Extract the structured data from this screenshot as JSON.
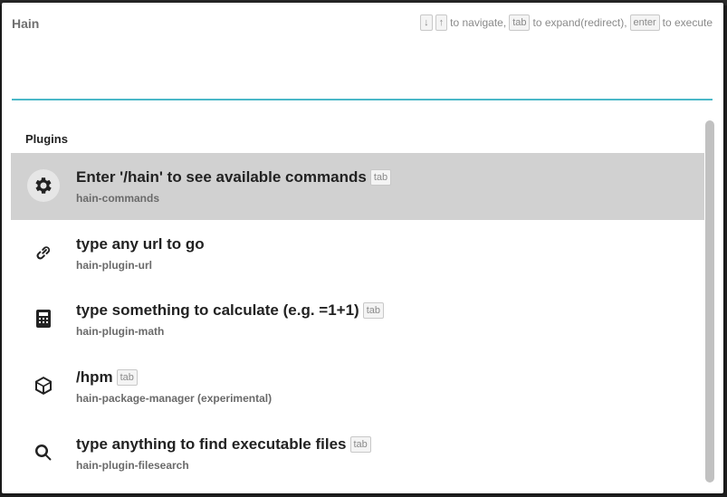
{
  "app": {
    "title": "Hain"
  },
  "help": {
    "key_down": "↓",
    "key_up": "↑",
    "navigate_text": "to navigate,",
    "key_tab": "tab",
    "expand_text": "to expand(redirect),",
    "key_enter": "enter",
    "execute_text": "to execute"
  },
  "search": {
    "value": ""
  },
  "section": {
    "title": "Plugins"
  },
  "items": [
    {
      "icon": "gear-icon",
      "title": "Enter '/hain' to see available commands",
      "tab": "tab",
      "subtitle": "hain-commands",
      "selected": true
    },
    {
      "icon": "link-icon",
      "title": "type any url to go",
      "tab": "",
      "subtitle": "hain-plugin-url",
      "selected": false
    },
    {
      "icon": "calculator-icon",
      "title": "type something to calculate (e.g. =1+1)",
      "tab": "tab",
      "subtitle": "hain-plugin-math",
      "selected": false
    },
    {
      "icon": "cube-icon",
      "title": "/hpm",
      "tab": "tab",
      "subtitle": "hain-package-manager (experimental)",
      "selected": false
    },
    {
      "icon": "search-icon",
      "title": "type anything to find executable files",
      "tab": "tab",
      "subtitle": "hain-plugin-filesearch",
      "selected": false
    }
  ],
  "colors": {
    "accent": "#4bb8c8",
    "selected_bg": "#d1d1d1"
  }
}
